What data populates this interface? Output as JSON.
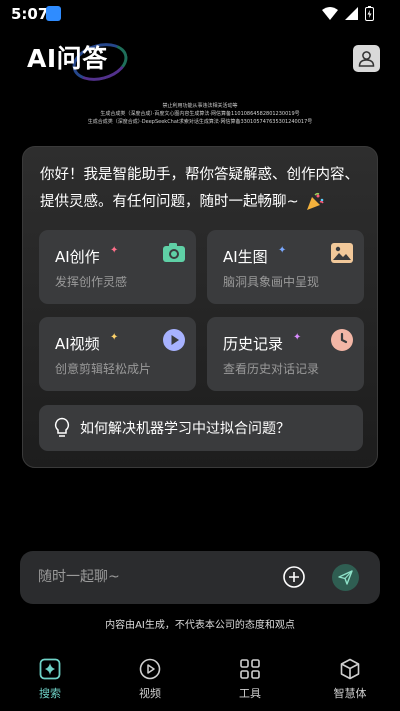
{
  "status_bar": {
    "time": "5:07"
  },
  "header": {
    "title": "AI问答"
  },
  "filing": {
    "line1": "禁止利用功能从事违法相关活动等",
    "line2": "生成合成类（深度合成）·百度文心图内容生成算法·网信算备11010864582801230019号",
    "line3": "生成合成类（深度合成）·DeepSeekChat求索对话生成算法·网信算备330105747635301240017号"
  },
  "greeting": {
    "text": "你好！我是智能助手，帮你答疑解惑、创作内容、提供灵感。有任何问题，随时一起畅聊~"
  },
  "features": [
    {
      "title": "AI创作",
      "subtitle": "发挥创作灵感",
      "sparkle_color": "#ff6f8a"
    },
    {
      "title": "AI生图",
      "subtitle": "脑洞具象画中呈现",
      "sparkle_color": "#7aa8ff"
    },
    {
      "title": "AI视频",
      "subtitle": "创意剪辑轻松成片",
      "sparkle_color": "#ffd36a"
    },
    {
      "title": "历史记录",
      "subtitle": "查看历史对话记录",
      "sparkle_color": "#d98bff"
    }
  ],
  "suggestion": {
    "text": "如何解决机器学习中过拟合问题？"
  },
  "input": {
    "placeholder": "随时一起聊~"
  },
  "disclaimer": "内容由AI生成，不代表本公司的态度和观点",
  "nav": [
    {
      "label": "搜索",
      "active": true
    },
    {
      "label": "视频",
      "active": false
    },
    {
      "label": "工具",
      "active": false
    },
    {
      "label": "智慧体",
      "active": false
    }
  ],
  "colors": {
    "accent": "#6fd2c7",
    "card": "#3a3b3d",
    "send": "#2f5e52"
  }
}
